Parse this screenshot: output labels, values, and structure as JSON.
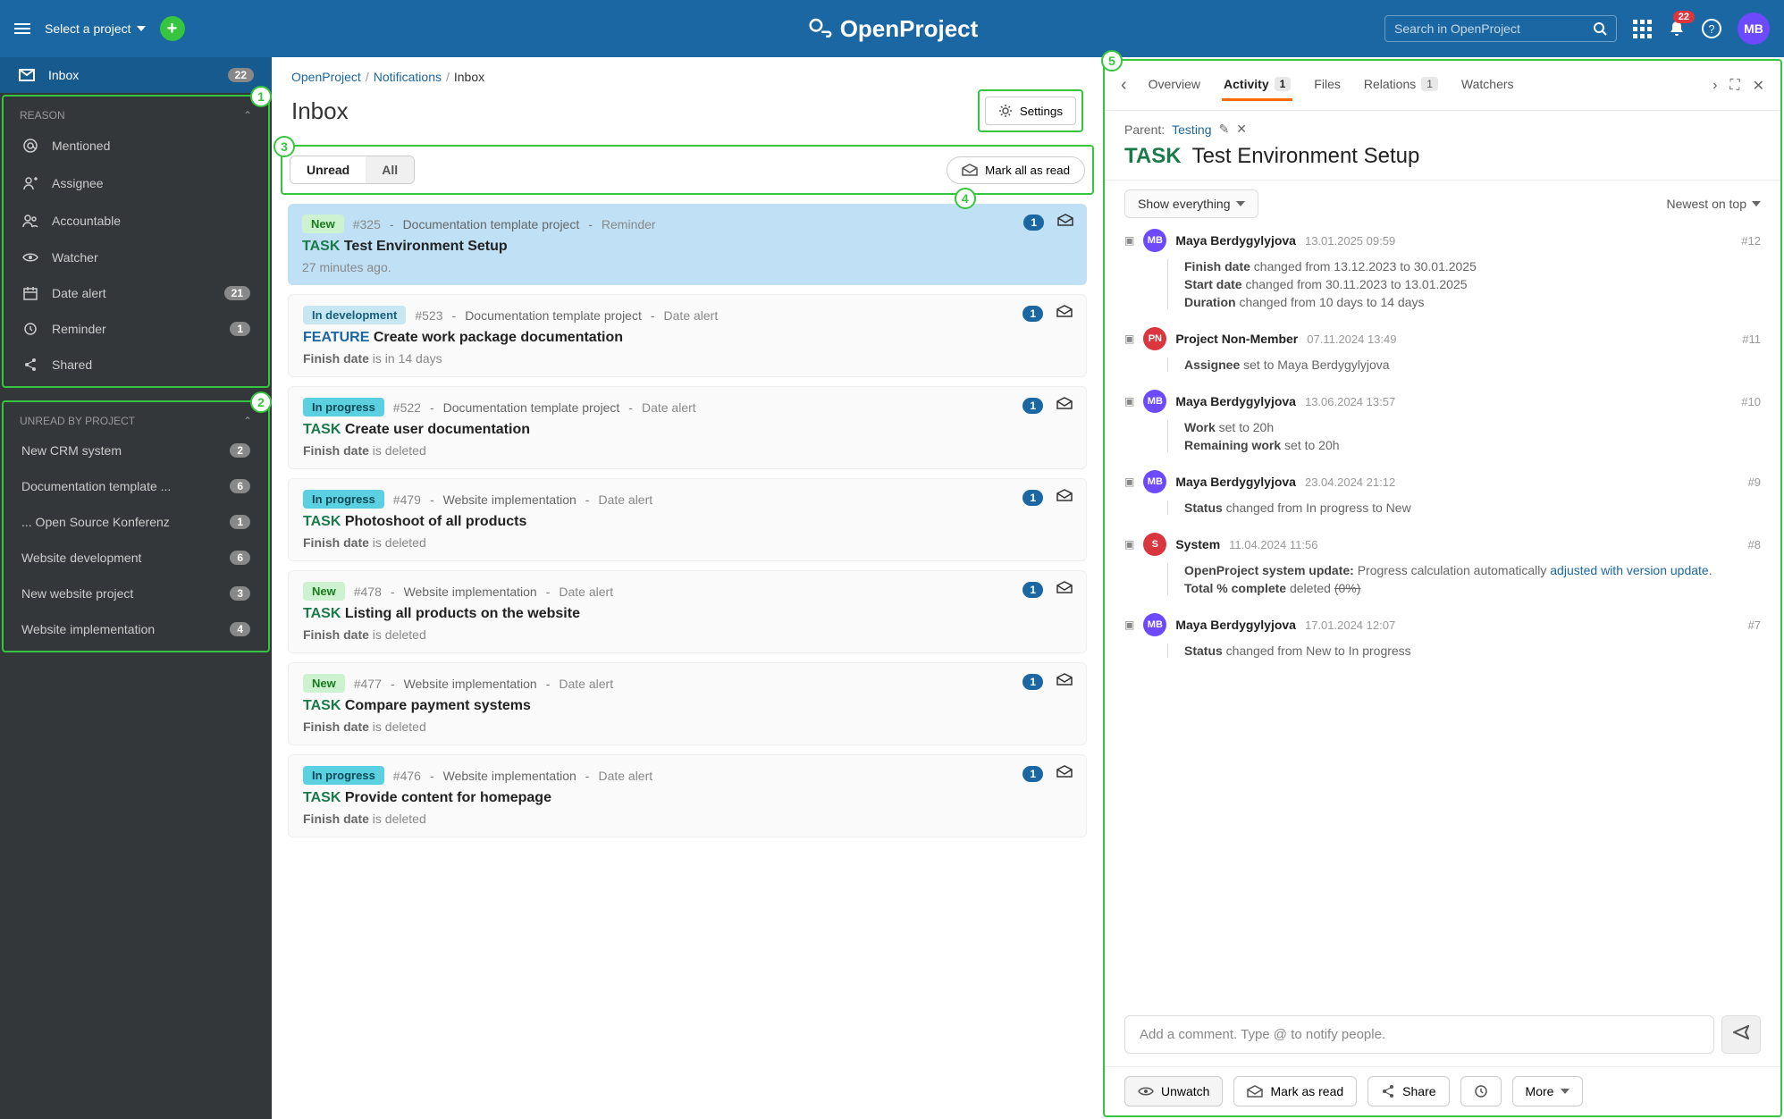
{
  "header": {
    "project_selector": "Select a project",
    "search_placeholder": "Search in OpenProject",
    "logo_text": "OpenProject",
    "bell_count": "22",
    "avatar": "MB"
  },
  "sidebar": {
    "inbox_label": "Inbox",
    "inbox_count": "22",
    "section_reason": "REASON",
    "reason_items": [
      {
        "icon": "at",
        "label": "Mentioned",
        "count": ""
      },
      {
        "icon": "user",
        "label": "Assignee",
        "count": ""
      },
      {
        "icon": "users",
        "label": "Accountable",
        "count": ""
      },
      {
        "icon": "eye",
        "label": "Watcher",
        "count": ""
      },
      {
        "icon": "calendar",
        "label": "Date alert",
        "count": "21"
      },
      {
        "icon": "clock",
        "label": "Reminder",
        "count": "1"
      },
      {
        "icon": "share",
        "label": "Shared",
        "count": ""
      }
    ],
    "section_unread": "UNREAD BY PROJECT",
    "projects": [
      {
        "label": "New CRM system",
        "count": "2"
      },
      {
        "label": "Documentation template ...",
        "count": "6"
      },
      {
        "label": "... Open Source Konferenz",
        "count": "1"
      },
      {
        "label": "Website development",
        "count": "6"
      },
      {
        "label": "New website project",
        "count": "3"
      },
      {
        "label": "Website implementation",
        "count": "4"
      }
    ]
  },
  "center": {
    "breadcrumb": {
      "root": "OpenProject",
      "mid": "Notifications",
      "leaf": "Inbox"
    },
    "title": "Inbox",
    "settings_label": "Settings",
    "filter_unread": "Unread",
    "filter_all": "All",
    "mark_all_read": "Mark all as read",
    "items": [
      {
        "status": "New",
        "status_class": "chip-new",
        "id": "#325",
        "proj": "Documentation template project",
        "reason": "Reminder",
        "type": "TASK",
        "type_class": "task",
        "name": "Test Environment Setup",
        "sub_label": "",
        "sub_text": "27 minutes ago.",
        "count": "1",
        "selected": true
      },
      {
        "status": "In development",
        "status_class": "chip-dev",
        "id": "#523",
        "proj": "Documentation template project",
        "reason": "Date alert",
        "type": "FEATURE",
        "type_class": "feature",
        "name": "Create work package documentation",
        "sub_label": "Finish date",
        "sub_text": " is in 14 days",
        "count": "1"
      },
      {
        "status": "In progress",
        "status_class": "chip-prog",
        "id": "#522",
        "proj": "Documentation template project",
        "reason": "Date alert",
        "type": "TASK",
        "type_class": "task",
        "name": "Create user documentation",
        "sub_label": "Finish date",
        "sub_text": " is deleted",
        "count": "1"
      },
      {
        "status": "In progress",
        "status_class": "chip-prog",
        "id": "#479",
        "proj": "Website implementation",
        "reason": "Date alert",
        "type": "TASK",
        "type_class": "task",
        "name": "Photoshoot of all products",
        "sub_label": "Finish date",
        "sub_text": " is deleted",
        "count": "1"
      },
      {
        "status": "New",
        "status_class": "chip-new",
        "id": "#478",
        "proj": "Website implementation",
        "reason": "Date alert",
        "type": "TASK",
        "type_class": "task",
        "name": "Listing all products on the website",
        "sub_label": "Finish date",
        "sub_text": " is deleted",
        "count": "1"
      },
      {
        "status": "New",
        "status_class": "chip-new",
        "id": "#477",
        "proj": "Website implementation",
        "reason": "Date alert",
        "type": "TASK",
        "type_class": "task",
        "name": "Compare payment systems",
        "sub_label": "Finish date",
        "sub_text": " is deleted",
        "count": "1"
      },
      {
        "status": "In progress",
        "status_class": "chip-prog",
        "id": "#476",
        "proj": "Website implementation",
        "reason": "Date alert",
        "type": "TASK",
        "type_class": "task",
        "name": "Provide content for homepage",
        "sub_label": "Finish date",
        "sub_text": " is deleted",
        "count": "1"
      }
    ]
  },
  "detail": {
    "tabs": {
      "overview": "Overview",
      "activity": "Activity",
      "activity_count": "1",
      "files": "Files",
      "relations": "Relations",
      "relations_count": "1",
      "watchers": "Watchers"
    },
    "parent_label": "Parent:",
    "parent_link": "Testing",
    "wp_type": "TASK",
    "wp_name": "Test Environment Setup",
    "show_label": "Show everything",
    "sort_label": "Newest on top",
    "activities": [
      {
        "avatar": "MB",
        "av_class": "av-mb",
        "user": "Maya Berdygylyjova",
        "time": "13.01.2025 09:59",
        "num": "#12",
        "changes": [
          {
            "html": "<b>Finish date</b> changed from 13.12.2023 to 30.01.2025"
          },
          {
            "html": "<b>Start date</b> changed from 30.11.2023 to 13.01.2025"
          },
          {
            "html": "<b>Duration</b> changed from 10 days to 14 days"
          }
        ]
      },
      {
        "avatar": "PN",
        "av_class": "av-pn",
        "user": "Project Non-Member",
        "time": "07.11.2024 13:49",
        "num": "#11",
        "changes": [
          {
            "html": "<b>Assignee</b> set to Maya Berdygylyjova"
          }
        ]
      },
      {
        "avatar": "MB",
        "av_class": "av-mb",
        "user": "Maya Berdygylyjova",
        "time": "13.06.2024 13:57",
        "num": "#10",
        "changes": [
          {
            "html": "<b>Work</b> set to 20h"
          },
          {
            "html": "<b>Remaining work</b> set to 20h"
          }
        ]
      },
      {
        "avatar": "MB",
        "av_class": "av-mb",
        "user": "Maya Berdygylyjova",
        "time": "23.04.2024 21:12",
        "num": "#9",
        "changes": [
          {
            "html": "<b>Status</b> changed from In progress to New"
          }
        ]
      },
      {
        "avatar": "S",
        "av_class": "av-s",
        "user": "System",
        "time": "11.04.2024 11:56",
        "num": "#8",
        "changes": [
          {
            "html": "<b>OpenProject system update:</b> Progress calculation automatically <a href='#'>adjusted with version update</a>."
          },
          {
            "html": "<b>Total % complete</b> deleted <span class='strike'>(0%)</span>"
          }
        ]
      },
      {
        "avatar": "MB",
        "av_class": "av-mb",
        "user": "Maya Berdygylyjova",
        "time": "17.01.2024 12:07",
        "num": "#7",
        "changes": [
          {
            "html": "<b>Status</b> changed from New to In progress"
          }
        ]
      }
    ],
    "comment_placeholder": "Add a comment. Type @ to notify people.",
    "actions": {
      "unwatch": "Unwatch",
      "mark_read": "Mark as read",
      "share": "Share",
      "more": "More"
    }
  }
}
